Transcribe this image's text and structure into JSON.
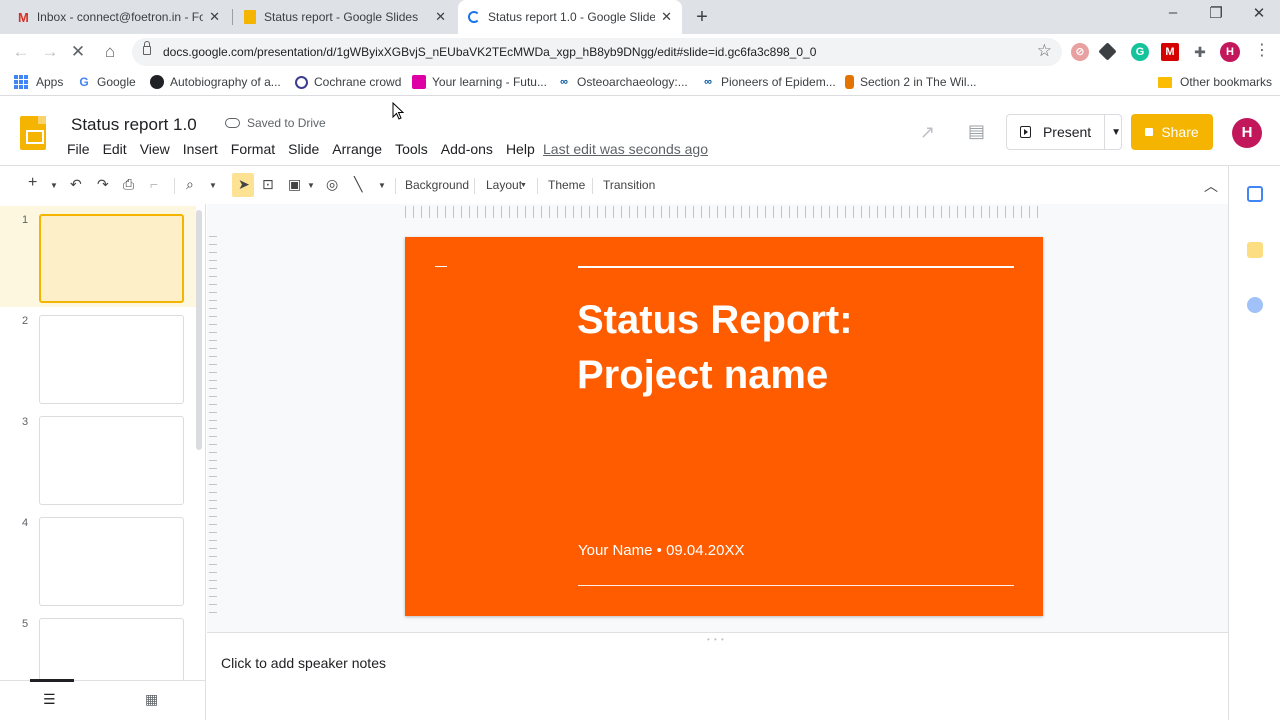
{
  "browser": {
    "tabs": [
      {
        "title": "Inbox - connect@foetron.in - Fo",
        "icon": "gmail-icon",
        "active": false
      },
      {
        "title": "Status report - Google Slides",
        "icon": "slides-icon",
        "active": false
      },
      {
        "title": "Status report 1.0 - Google Slides",
        "icon": "loading-icon",
        "active": true
      }
    ],
    "url": "docs.google.com/presentation/d/1gWByixXGBvjS_nEUbaVK2TEcMWDa_xgp_hB8yb9DNgg/edit#slide=id.gc6fa3c898_0_0",
    "profile_initial": "H",
    "bookmarks": [
      {
        "label": "Apps",
        "icon": "apps-grid-icon"
      },
      {
        "label": "Google",
        "icon": "google-icon"
      },
      {
        "label": "Autobiography of a...",
        "icon": "world-icon"
      },
      {
        "label": "Cochrane crowd",
        "icon": "cochrane-icon"
      },
      {
        "label": "Your learning - Futu...",
        "icon": "futurelearn-icon"
      },
      {
        "label": "Osteoarchaeology:...",
        "icon": "link-icon"
      },
      {
        "label": "Pioneers of Epidem...",
        "icon": "link-icon"
      },
      {
        "label": "Section 2 in The Wil...",
        "icon": "bottle-icon"
      }
    ],
    "other_bookmarks": "Other bookmarks"
  },
  "app": {
    "title": "Status report 1.0",
    "saved_status": "Saved to Drive",
    "menu": [
      "File",
      "Edit",
      "View",
      "Insert",
      "Format",
      "Slide",
      "Arrange",
      "Tools",
      "Add-ons",
      "Help"
    ],
    "last_edit": "Last edit was seconds ago",
    "present_label": "Present",
    "share_label": "Share",
    "user_initial": "H",
    "brand_color": "#f4b400",
    "avatar_color": "#c2185b"
  },
  "toolbar": {
    "background_label": "Background",
    "layout_label": "Layout",
    "theme_label": "Theme",
    "transition_label": "Transition"
  },
  "filmstrip": {
    "slides": [
      "1",
      "2",
      "3",
      "4",
      "5"
    ],
    "selected": "1"
  },
  "slide": {
    "title_line1": "Status Report:",
    "title_line2": "Project name",
    "subtitle": "Your Name • 09.04.20XX",
    "background_color": "#ff5c00"
  },
  "notes": {
    "placeholder": "Click to add speaker notes"
  }
}
